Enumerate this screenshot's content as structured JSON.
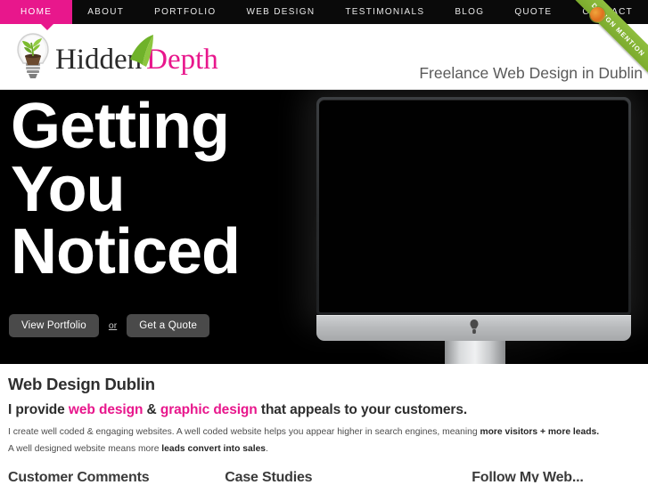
{
  "nav": {
    "items": [
      {
        "label": "HOME",
        "active": true
      },
      {
        "label": "ABOUT",
        "active": false
      },
      {
        "label": "PORTFOLIO",
        "active": false
      },
      {
        "label": "WEB DESIGN",
        "active": false
      },
      {
        "label": "TESTIMONIALS",
        "active": false
      },
      {
        "label": "BLOG",
        "active": false
      },
      {
        "label": "QUOTE",
        "active": false
      },
      {
        "label": "CONTACT",
        "active": false
      }
    ],
    "active_color": "#e8178c",
    "background": "#0a0a0a"
  },
  "ribbon": {
    "text": "DESIGN MENTION",
    "color": "#8fbe3e"
  },
  "header": {
    "logo": {
      "primary": "Hidden",
      "secondary": "Depth",
      "secondary_color": "#e8178c"
    },
    "tagline": "Freelance Web Design in Dublin"
  },
  "hero": {
    "headline_lines": [
      "Getting",
      "You",
      "Noticed"
    ],
    "primary_button": "View Portfolio",
    "separator": "or",
    "secondary_button": "Get a Quote",
    "background": "#000000"
  },
  "main": {
    "title": "Web Design Dublin",
    "subtitle": {
      "part1": "I provide ",
      "highlight1": "web design",
      "part2": " & ",
      "highlight2": "graphic design",
      "part3": " that appeals to your customers."
    },
    "paragraph1": {
      "text": "I create well coded & engaging websites. A well coded website helps you appear higher in search engines, meaning ",
      "bold": "more visitors + more leads."
    },
    "paragraph2": {
      "text": "A well designed website means more ",
      "bold": "leads convert into sales",
      "tail": "."
    }
  },
  "bottom_sections": [
    {
      "label": "Customer Comments"
    },
    {
      "label": "Case Studies"
    },
    {
      "label": "Follow My Web..."
    }
  ]
}
